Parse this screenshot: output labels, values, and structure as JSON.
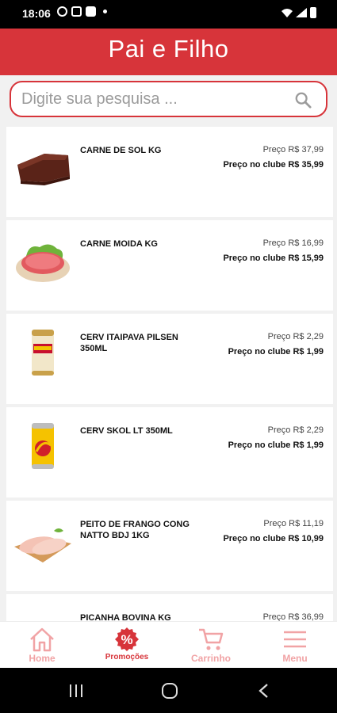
{
  "status_bar": {
    "time": "18:06"
  },
  "app": {
    "title": "Pai e Filho",
    "accent": "#d7343a"
  },
  "search": {
    "placeholder": "Digite sua pesquisa ...",
    "value": "",
    "icon": "search-icon"
  },
  "products": [
    {
      "name": "CARNE DE SOL KG",
      "price": "Preço R$ 37,99",
      "club_price": "Preço no clube R$ 35,99",
      "image": "carne-de-sol"
    },
    {
      "name": "CARNE MOIDA KG",
      "price": "Preço R$ 16,99",
      "club_price": "Preço no clube R$ 15,99",
      "image": "carne-moida"
    },
    {
      "name": "CERV ITAIPAVA PILSEN 350ML",
      "price": "Preço R$ 2,29",
      "club_price": "Preço no clube R$ 1,99",
      "image": "itaipava-can"
    },
    {
      "name": "CERV SKOL LT 350ML",
      "price": "Preço R$ 2,29",
      "club_price": "Preço no clube R$ 1,99",
      "image": "skol-can"
    },
    {
      "name": "PEITO DE FRANGO CONG NATTO BDJ 1KG",
      "price": "Preço R$ 11,19",
      "club_price": "Preço no clube R$ 10,99",
      "image": "chicken-breast"
    },
    {
      "name": "PICANHA BOVINA KG",
      "price": "Preço R$ 36,99",
      "club_price": "",
      "image": "picanha"
    }
  ],
  "bottom_nav": {
    "home": "Home",
    "promos": "Promoções",
    "cart": "Carrinho",
    "menu": "Menu",
    "active": "promos"
  }
}
